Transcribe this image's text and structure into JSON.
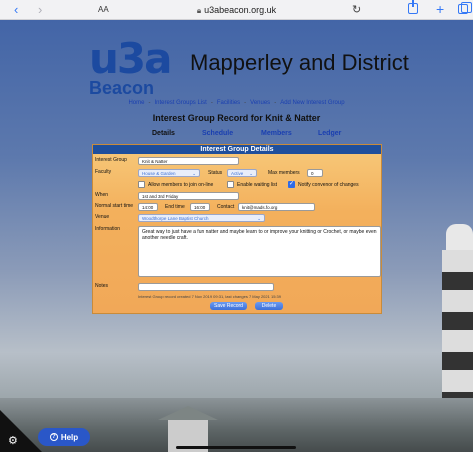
{
  "browser": {
    "text_size": "AA",
    "url": "u3abeacon.org.uk",
    "back_glyph": "‹",
    "forward_glyph": "›",
    "reload_glyph": "↻",
    "newtab_glyph": "+"
  },
  "header": {
    "logo_main": "u3a",
    "logo_sub": "Beacon",
    "site_title": "Mapperley and District"
  },
  "nav": {
    "links": [
      "Home",
      "Interest Groups List",
      "Facilities",
      "Venues",
      "Add New Interest Group"
    ],
    "separator": "-"
  },
  "page_heading": "Interest Group Record for Knit & Natter",
  "subnav": {
    "details": "Details",
    "schedule": "Schedule",
    "members": "Members",
    "ledger": "Ledger"
  },
  "form": {
    "title": "Interest Group Details",
    "interest_group_label": "Interest Group",
    "interest_group_value": "Knit & Natter",
    "faculty_label": "Faculty",
    "faculty_value": "House & Garden",
    "status_label": "Status",
    "status_value": "Active",
    "max_members_label": "Max members",
    "max_members_value": "0",
    "allow_online_label": "Allow members to join on-line",
    "allow_online_checked": false,
    "waiting_list_label": "Enable waiting list",
    "waiting_list_checked": false,
    "notify_label": "Notify convenor of changes",
    "notify_checked": true,
    "when_label": "When",
    "when_value": "1st and 3rd Friday",
    "start_time_label": "Normal start time",
    "start_time_value": "14:00",
    "end_time_label": "End time",
    "end_time_value": "16:00",
    "contact_label": "Contact",
    "contact_value": "knit@mads.fo.org",
    "venue_label": "Venue",
    "venue_value": "Woodthorpe Lane Baptist Church",
    "information_label": "Information",
    "information_value": "Great way to just have a fun natter and maybe learn to or improve your knitting or Crochet, or maybe even another needle craft.",
    "notes_label": "Notes",
    "notes_value": "",
    "meta_text": "Interest Group record created 7 Nov 2019 09:31, last changes 7 May 2021 15:39",
    "save_label": "Save Record",
    "delete_label": "Delete"
  },
  "help": {
    "label": "Help",
    "icon": "?"
  },
  "icons": {
    "gear": "gear-icon",
    "help": "help-icon",
    "lock": "lock-icon"
  },
  "colors": {
    "brand_blue": "#1c4aa0",
    "panel_header": "#1f4f9c",
    "panel_orange": "#f3b05c",
    "button_blue": "#3e70d8"
  }
}
